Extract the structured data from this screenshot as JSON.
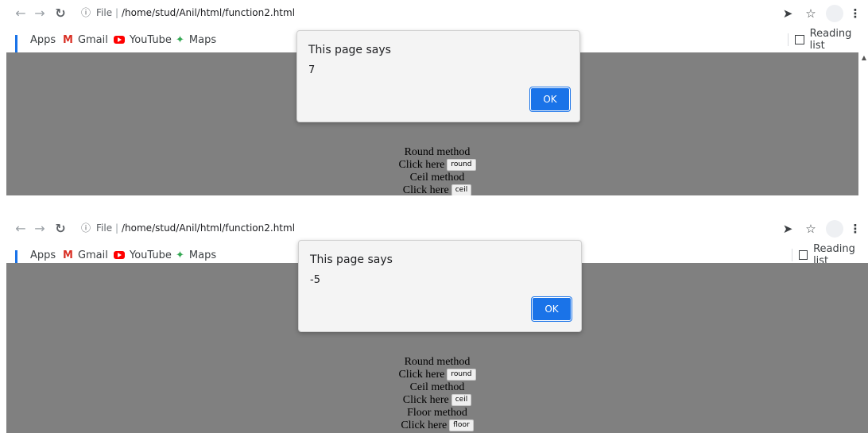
{
  "browser": {
    "file_label": "File",
    "separator": "|",
    "url": "/home/stud/Anil/html/function2.html",
    "bookmarks": [
      {
        "label": "Apps",
        "icon": "apps-grid-icon"
      },
      {
        "label": "Gmail",
        "icon": "gmail-icon"
      },
      {
        "label": "YouTube",
        "icon": "youtube-icon"
      },
      {
        "label": "Maps",
        "icon": "maps-icon"
      }
    ],
    "reading_list": "Reading list",
    "gmail_glyph": "M"
  },
  "page": {
    "round_heading": "Round method",
    "click_here": "Click here",
    "round_button": "round",
    "ceil_heading": "Ceil method",
    "ceil_button": "ceil",
    "floor_heading": "Floor method",
    "floor_button": "floor"
  },
  "dialogs": [
    {
      "title": "This page says",
      "message": "7",
      "ok": "OK"
    },
    {
      "title": "This page says",
      "message": "-5",
      "ok": "OK"
    }
  ],
  "colors": {
    "page_background": "#808080",
    "ok_button": "#1a73e8",
    "dialog_background": "#f4f4f4"
  }
}
